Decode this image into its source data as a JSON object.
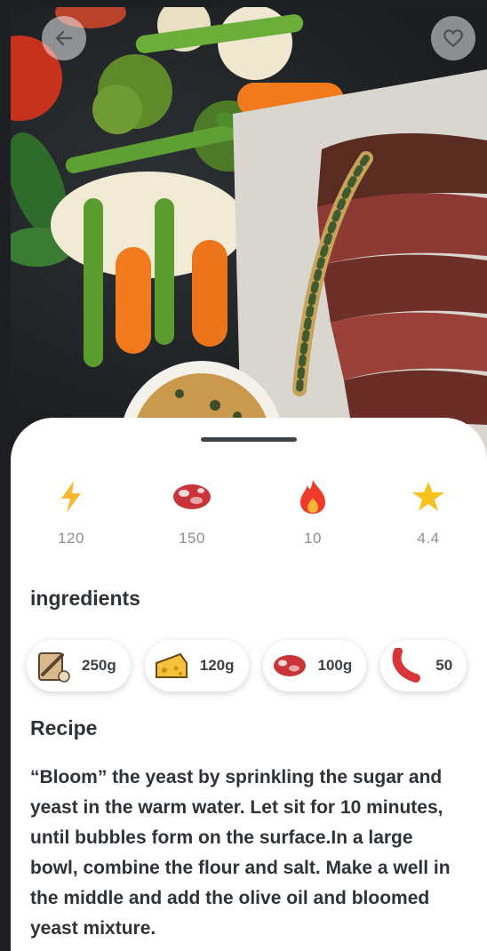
{
  "stats": [
    {
      "icon": "lightning-icon",
      "value": "120"
    },
    {
      "icon": "meat-icon",
      "value": "150"
    },
    {
      "icon": "fire-icon",
      "value": "10"
    },
    {
      "icon": "star-icon",
      "value": "4.4"
    }
  ],
  "ingredients": {
    "title": "ingredients",
    "items": [
      {
        "icon": "flour-bag-icon",
        "amount": "250g"
      },
      {
        "icon": "cheese-icon",
        "amount": "120g"
      },
      {
        "icon": "meat-icon",
        "amount": "100g"
      },
      {
        "icon": "sausage-icon",
        "amount": "50"
      }
    ]
  },
  "recipe": {
    "title": "Recipe",
    "text": "“Bloom” the yeast by sprinkling the sugar and yeast in the warm water. Let sit for 10 minutes, until bubbles form on the surface.In a large bowl, combine the flour and salt. Make a well in the middle and add the olive oil and bloomed yeast mixture."
  },
  "colors": {
    "lightning": "#f7b733",
    "meat": "#c8343a",
    "fire": "#f03a2a",
    "star": "#f8c21c"
  }
}
